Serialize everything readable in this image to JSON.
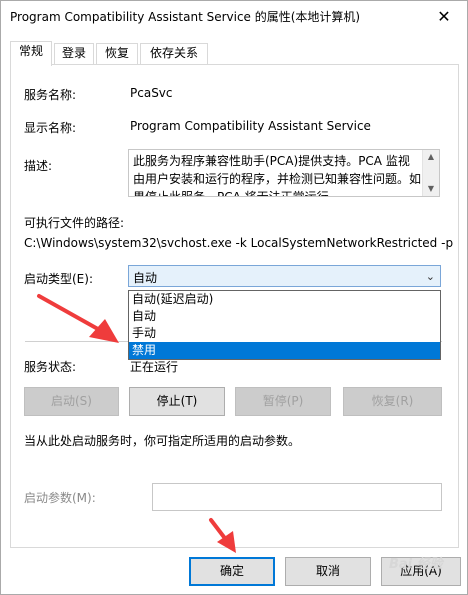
{
  "window": {
    "title": "Program Compatibility Assistant Service 的属性(本地计算机)",
    "close_glyph": "✕"
  },
  "tabs": [
    {
      "label": "常规"
    },
    {
      "label": "登录"
    },
    {
      "label": "恢复"
    },
    {
      "label": "依存关系"
    }
  ],
  "general": {
    "service_name_label": "服务名称:",
    "service_name_value": "PcaSvc",
    "display_name_label": "显示名称:",
    "display_name_value": "Program Compatibility Assistant Service",
    "description_label": "描述:",
    "description_value": "此服务为程序兼容性助手(PCA)提供支持。PCA 监视由用户安装和运行的程序，并检测已知兼容性问题。如果停止此服务，PCA 将无法正常运行",
    "exe_path_label": "可执行文件的路径:",
    "exe_path_value": "C:\\Windows\\system32\\svchost.exe -k LocalSystemNetworkRestricted -p",
    "startup_type_label": "启动类型(E):",
    "startup_type_value": "自动",
    "startup_options": [
      "自动(延迟启动)",
      "自动",
      "手动",
      "禁用"
    ],
    "highlighted_option": "禁用",
    "service_status_label": "服务状态:",
    "service_status_value": "正在运行",
    "buttons": {
      "start": "启动(S)",
      "stop": "停止(T)",
      "pause": "暂停(P)",
      "resume": "恢复(R)"
    },
    "hint_text": "当从此处启动服务时，你可指定所适用的启动参数。",
    "start_params_label": "启动参数(M):",
    "start_params_value": ""
  },
  "footer": {
    "ok": "确定",
    "cancel": "取消",
    "apply": "应用(A)"
  },
  "watermark": "Bai 经验",
  "colors": {
    "accent": "#0078d7",
    "annotation_arrow": "#ef3c3c"
  }
}
